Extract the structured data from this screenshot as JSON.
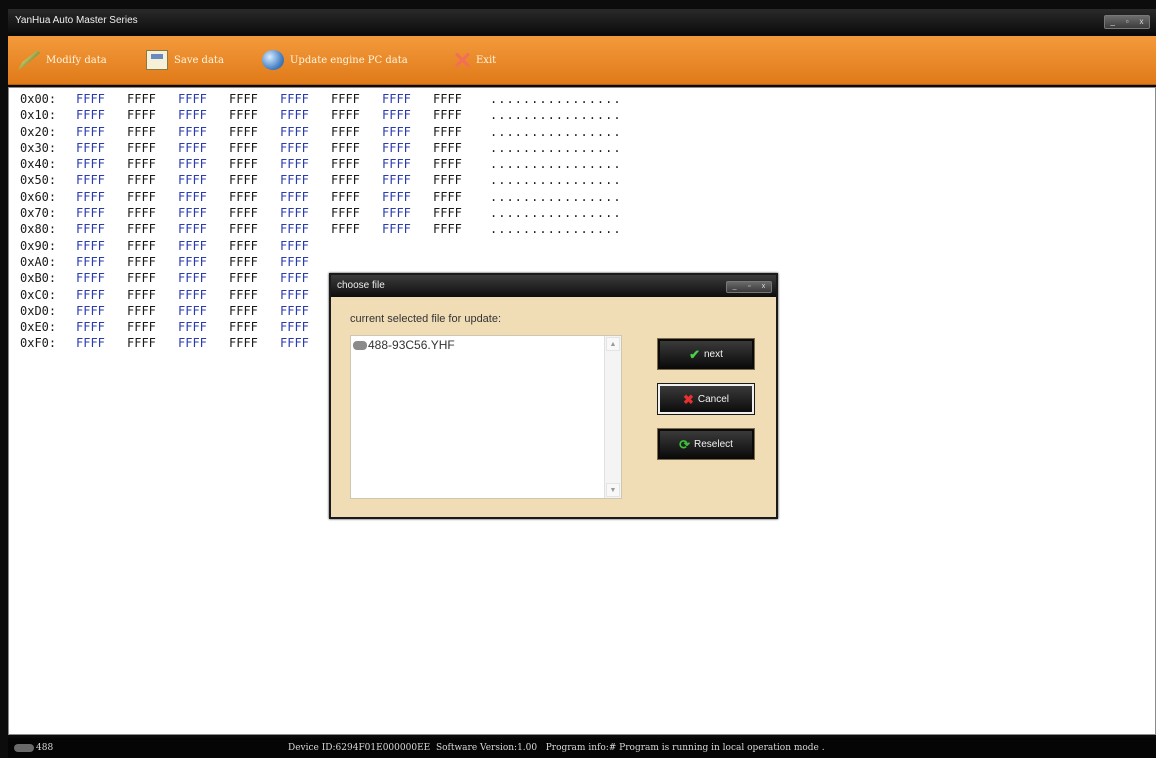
{
  "window": {
    "title": "YanHua Auto Master Series",
    "controls": [
      "_",
      "▫",
      "x"
    ]
  },
  "toolbar": {
    "modify_label": "Modify data",
    "save_label": "Save data",
    "update_label": "Update engine PC data",
    "exit_label": "Exit"
  },
  "hex": {
    "rows": [
      {
        "offset": "0x00:",
        "words": [
          "FFFF",
          "FFFF",
          "FFFF",
          "FFFF",
          "FFFF",
          "FFFF",
          "FFFF",
          "FFFF"
        ],
        "ascii": "................"
      },
      {
        "offset": "0x10:",
        "words": [
          "FFFF",
          "FFFF",
          "FFFF",
          "FFFF",
          "FFFF",
          "FFFF",
          "FFFF",
          "FFFF"
        ],
        "ascii": "................"
      },
      {
        "offset": "0x20:",
        "words": [
          "FFFF",
          "FFFF",
          "FFFF",
          "FFFF",
          "FFFF",
          "FFFF",
          "FFFF",
          "FFFF"
        ],
        "ascii": "................"
      },
      {
        "offset": "0x30:",
        "words": [
          "FFFF",
          "FFFF",
          "FFFF",
          "FFFF",
          "FFFF",
          "FFFF",
          "FFFF",
          "FFFF"
        ],
        "ascii": "................"
      },
      {
        "offset": "0x40:",
        "words": [
          "FFFF",
          "FFFF",
          "FFFF",
          "FFFF",
          "FFFF",
          "FFFF",
          "FFFF",
          "FFFF"
        ],
        "ascii": "................"
      },
      {
        "offset": "0x50:",
        "words": [
          "FFFF",
          "FFFF",
          "FFFF",
          "FFFF",
          "FFFF",
          "FFFF",
          "FFFF",
          "FFFF"
        ],
        "ascii": "................"
      },
      {
        "offset": "0x60:",
        "words": [
          "FFFF",
          "FFFF",
          "FFFF",
          "FFFF",
          "FFFF",
          "FFFF",
          "FFFF",
          "FFFF"
        ],
        "ascii": "................"
      },
      {
        "offset": "0x70:",
        "words": [
          "FFFF",
          "FFFF",
          "FFFF",
          "FFFF",
          "FFFF",
          "FFFF",
          "FFFF",
          "FFFF"
        ],
        "ascii": "................"
      },
      {
        "offset": "0x80:",
        "words": [
          "FFFF",
          "FFFF",
          "FFFF",
          "FFFF",
          "FFFF",
          "FFFF",
          "FFFF",
          "FFFF"
        ],
        "ascii": "................"
      },
      {
        "offset": "0x90:",
        "words": [
          "FFFF",
          "FFFF",
          "FFFF",
          "FFFF",
          "FFFF"
        ],
        "ascii": ""
      },
      {
        "offset": "0xA0:",
        "words": [
          "FFFF",
          "FFFF",
          "FFFF",
          "FFFF",
          "FFFF"
        ],
        "ascii": ""
      },
      {
        "offset": "0xB0:",
        "words": [
          "FFFF",
          "FFFF",
          "FFFF",
          "FFFF",
          "FFFF"
        ],
        "ascii": ""
      },
      {
        "offset": "0xC0:",
        "words": [
          "FFFF",
          "FFFF",
          "FFFF",
          "FFFF",
          "FFFF"
        ],
        "ascii": ""
      },
      {
        "offset": "0xD0:",
        "words": [
          "FFFF",
          "FFFF",
          "FFFF",
          "FFFF",
          "FFFF"
        ],
        "ascii": ""
      },
      {
        "offset": "0xE0:",
        "words": [
          "FFFF",
          "FFFF",
          "FFFF",
          "FFFF",
          "FFFF"
        ],
        "ascii": ""
      },
      {
        "offset": "0xF0:",
        "words": [
          "FFFF",
          "FFFF",
          "FFFF",
          "FFFF",
          "FFFF"
        ],
        "ascii": ""
      }
    ]
  },
  "dialog": {
    "title": "choose file",
    "controls": [
      "_",
      "▫",
      "x"
    ],
    "label": "current selected file for update:",
    "file": "488-93C56.YHF",
    "next_label": "next",
    "cancel_label": "Cancel",
    "reselect_label": "Reselect"
  },
  "status": {
    "left": "488",
    "device": "Device ID:6294F01E000000EE",
    "software": "Software Version:1.00",
    "program": "Program info:# Program is running in local operation mode ."
  },
  "colors": {
    "toolbar": "#e88a2a",
    "dialog_bg": "#f0ddb6",
    "hex_blue": "#2a3ab0"
  }
}
